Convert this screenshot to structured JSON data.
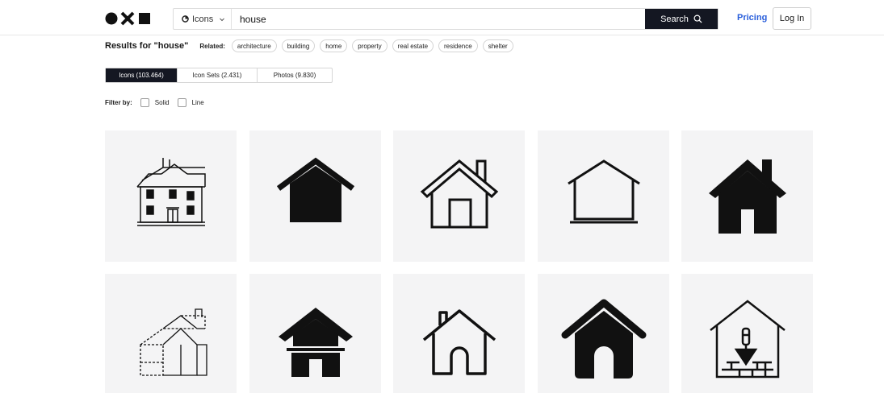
{
  "header": {
    "search_type_label": "Icons",
    "search_value": "house",
    "search_button_label": "Search",
    "pricing_label": "Pricing",
    "login_label": "Log In"
  },
  "results": {
    "title": "Results for \"house\"",
    "related_label": "Related:",
    "related_chips": [
      "architecture",
      "building",
      "home",
      "property",
      "real estate",
      "residence",
      "shelter"
    ]
  },
  "tabs": [
    {
      "label": "Icons (103.464)",
      "active": true
    },
    {
      "label": "Icon Sets (2.431)",
      "active": false
    },
    {
      "label": "Photos (9.830)",
      "active": false
    }
  ],
  "filters": {
    "label": "Filter by:",
    "options": [
      "Solid",
      "Line"
    ]
  },
  "icons": [
    {
      "name": "victorian-house-icon"
    },
    {
      "name": "solid-house-icon"
    },
    {
      "name": "outline-house-chimney-icon"
    },
    {
      "name": "minimal-house-outline-icon"
    },
    {
      "name": "solid-house-chimney-icon"
    },
    {
      "name": "house-sketch-icon"
    },
    {
      "name": "solid-house-door-icon"
    },
    {
      "name": "outline-house-arch-door-icon"
    },
    {
      "name": "solid-house-arch-door-icon"
    },
    {
      "name": "house-construction-trowel-icon"
    }
  ]
}
